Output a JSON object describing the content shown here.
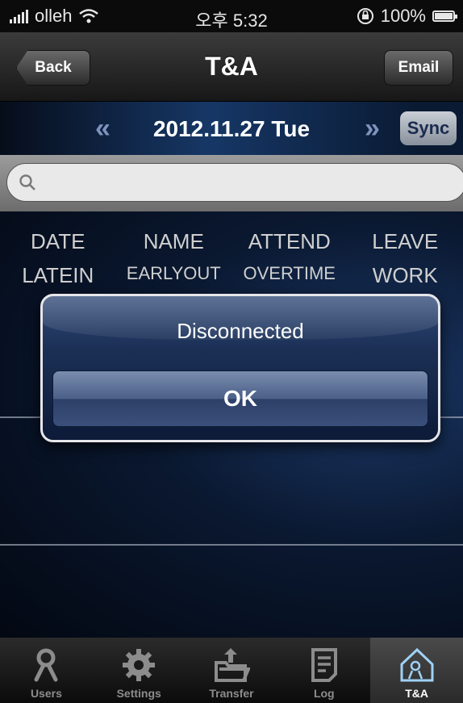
{
  "status_bar": {
    "carrier": "olleh",
    "time": "오후 5:32",
    "battery": "100%"
  },
  "nav": {
    "title": "T&A",
    "back_label": "Back",
    "email_label": "Email"
  },
  "date_bar": {
    "date": "2012.11.27 Tue",
    "sync_label": "Sync",
    "prev_icon": "double-chevron-left-icon",
    "next_icon": "double-chevron-right-icon"
  },
  "search": {
    "icon": "search-icon",
    "value": ""
  },
  "table": {
    "header_row1": [
      "DATE",
      "NAME",
      "ATTEND",
      "LEAVE"
    ],
    "header_row2": [
      "LATEIN",
      "EARLYOUT",
      "OVERTIME",
      "WORK"
    ]
  },
  "alert": {
    "title": "Disconnected",
    "ok_label": "OK"
  },
  "tab_bar": {
    "tabs": [
      {
        "label": "Users",
        "icon": "user-icon"
      },
      {
        "label": "Settings",
        "icon": "gear-icon"
      },
      {
        "label": "Transfer",
        "icon": "folder-transfer-icon"
      },
      {
        "label": "Log",
        "icon": "document-icon"
      },
      {
        "label": "T&A",
        "icon": "home-user-icon"
      }
    ],
    "active_tab": "T&A"
  },
  "colors": {
    "accent_blue": "#1b2f55",
    "active_tab_label": "#ffffff"
  }
}
